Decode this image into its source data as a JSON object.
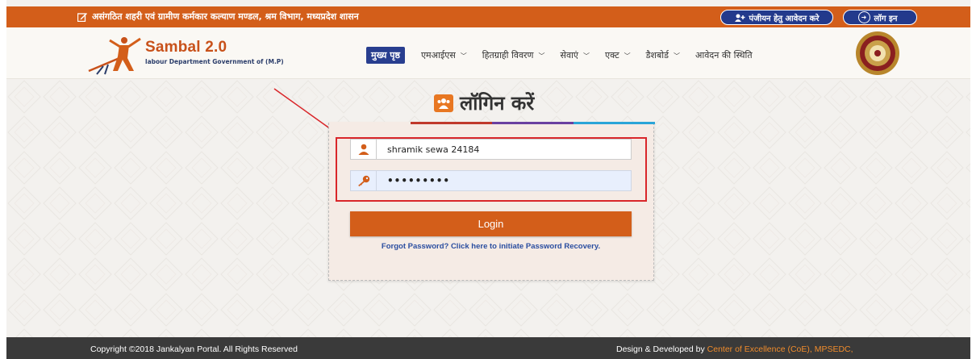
{
  "topbar": {
    "announcement": "असंगठित शहरी एवं ग्रामीण कर्मकार कल्याण मण्डल, श्रम विभाग, मध्यप्रदेश शासन",
    "register_label": "पंजीयन हेतु आवेदन करे",
    "login_label": "लॉग इन",
    "color": "#d35e1a"
  },
  "brand": {
    "name": "Sambal 2.0",
    "subtitle": "labour Department Government of (M.P)"
  },
  "nav": {
    "items": [
      {
        "label": "मुख्य पृष्ठ",
        "active": true
      },
      {
        "label": "एमआईएस",
        "dropdown": true
      },
      {
        "label": "हितग्राही विवरण",
        "dropdown": true
      },
      {
        "label": "सेवाएं",
        "dropdown": true
      },
      {
        "label": "एक्ट",
        "dropdown": true
      },
      {
        "label": "डैशबोर्ड",
        "dropdown": true
      },
      {
        "label": "आवेदन की स्थिति",
        "dropdown": false
      }
    ],
    "active_color": "#283e8f"
  },
  "login": {
    "title": "लॉगिन करें",
    "username_value": "shramik sewa 24184",
    "password_value": "•••••••••",
    "button_label": "Login",
    "forgot_text": "Forgot Password? Click here to initiate Password Recovery."
  },
  "footer": {
    "copyright": "Copyright ©2018 Jankalyan Portal. All Rights Reserved",
    "dev_prefix": "Design & Developed by ",
    "dev_link": "Center of Excellence (CoE), MPSEDC,"
  },
  "icons": {
    "edit": "edit-icon",
    "add_user": "add-user-icon",
    "login": "sign-in-icon",
    "users": "users-icon",
    "user": "user-icon",
    "key": "key-icon"
  }
}
